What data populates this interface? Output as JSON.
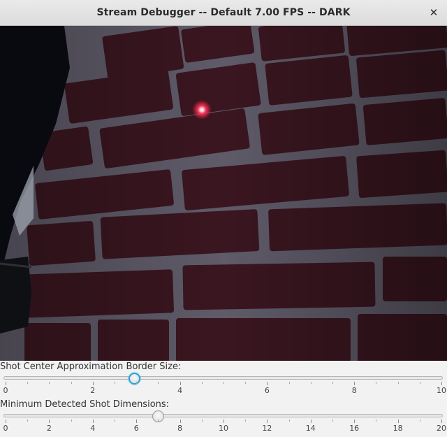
{
  "window": {
    "title": "Stream Debugger -- Default 7.00 FPS -- DARK",
    "close_glyph": "✕"
  },
  "video": {
    "description_icon": "camera-feed",
    "laser_color": "#ff3a5a"
  },
  "sliders": [
    {
      "label": "Shot Center Approximation Border Size:",
      "min": 0,
      "max": 10,
      "value": 2.96,
      "major_ticks": [
        "0",
        "2",
        "4",
        "6",
        "8",
        "10"
      ],
      "minor_per_major": 3,
      "focused": true
    },
    {
      "label": "Minimum Detected Shot Dimensions:",
      "min": 0,
      "max": 20,
      "value": 7.0,
      "major_ticks": [
        "0",
        "2",
        "4",
        "6",
        "8",
        "10",
        "12",
        "14",
        "16",
        "18",
        "20"
      ],
      "minor_per_major": 1,
      "focused": false
    }
  ],
  "colors": {
    "focus_ring": "#2aa3d6",
    "mortar": "#6e6a78",
    "brick": "#3a1620"
  }
}
